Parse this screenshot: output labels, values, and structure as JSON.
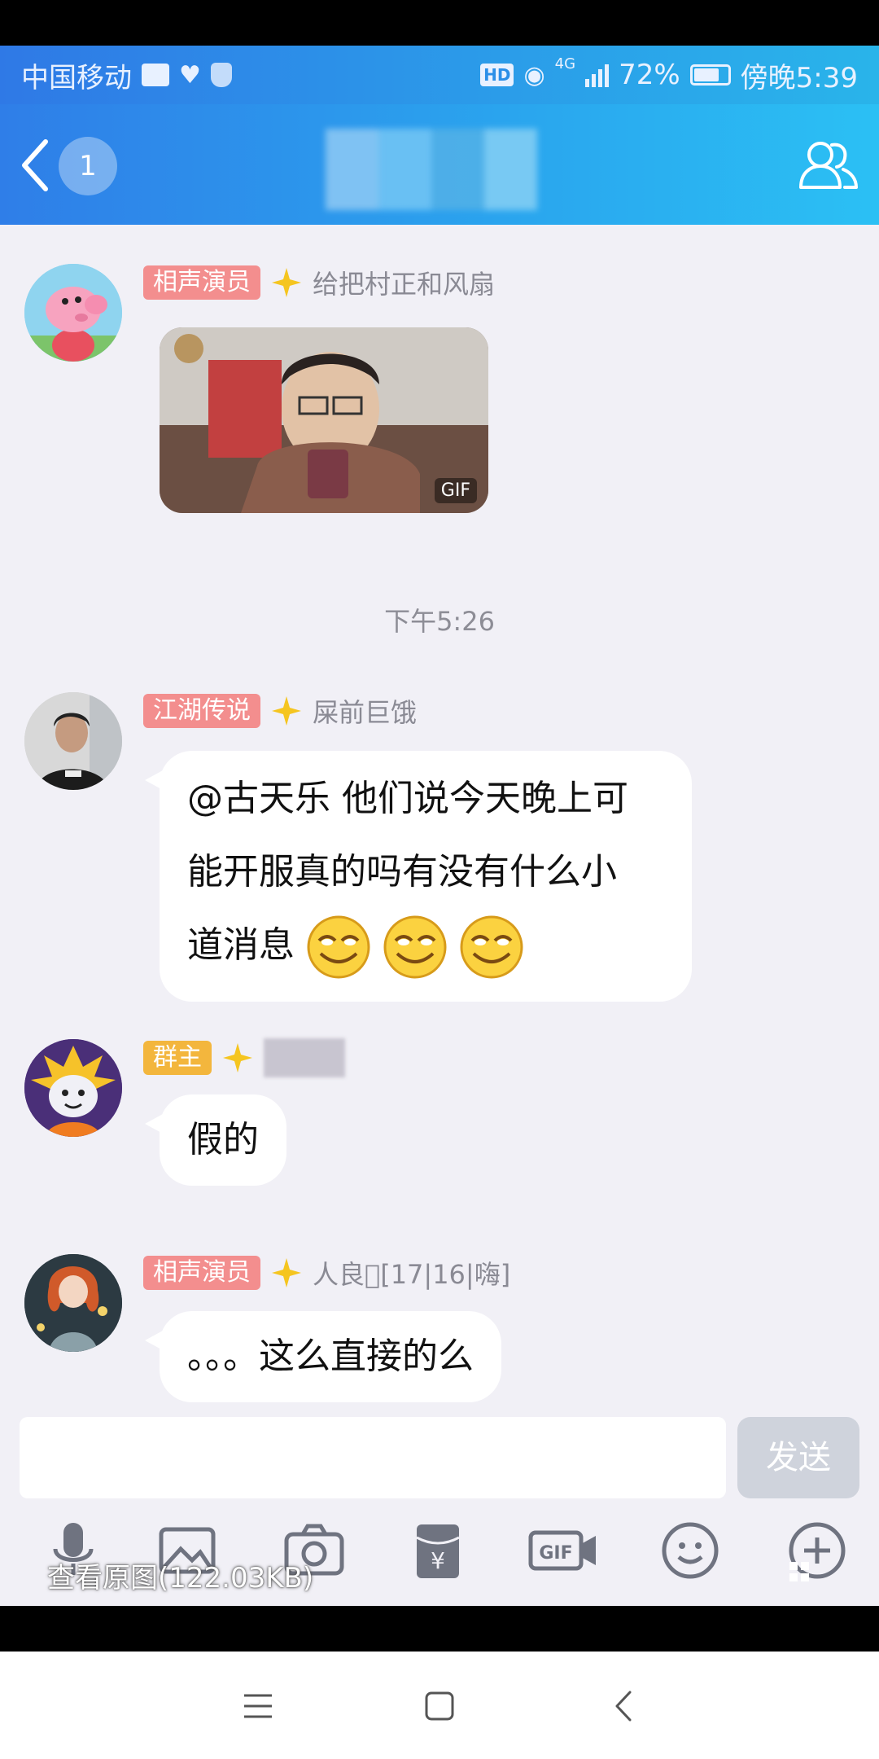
{
  "status_bar": {
    "carrier": "中国移动",
    "hd": "HD",
    "network": "4G",
    "battery": "72%",
    "time": "傍晚5:39"
  },
  "header": {
    "unread_count": "1",
    "title": ""
  },
  "messages": [
    {
      "tag": "相声演员",
      "tag_color": "#f38e8e",
      "nickname": "给把村正和风扇",
      "type": "gif",
      "gif_label": "GIF"
    },
    {
      "type": "timestamp",
      "text": "下午5:26"
    },
    {
      "tag": "江湖传说",
      "tag_color": "#f38e8e",
      "nickname": "屎前巨饿",
      "type": "text",
      "lines": [
        "@古天乐 他们说今天晚上可",
        "能开服真的吗有没有什么小",
        "道消息"
      ]
    },
    {
      "tag": "群主",
      "tag_color": "#f3b63d",
      "nickname": "",
      "type": "text",
      "lines": [
        "假的"
      ]
    },
    {
      "tag": "相声演员",
      "tag_color": "#f38e8e",
      "nickname": "人良\u0000[17|16|嗨]",
      "type": "text",
      "lines": [
        "。。。这么直接的么"
      ]
    }
  ],
  "input": {
    "send_label": "发送"
  },
  "toolbar": {
    "icons": [
      "microphone-icon",
      "image-icon",
      "camera-icon",
      "red-packet-icon",
      "gif-icon",
      "emoji-icon",
      "plus-icon"
    ],
    "gif_text": "GIF",
    "red_packet_text": "¥"
  },
  "overlay": {
    "view_original": "查看原图(122.03KB)"
  },
  "colors": {
    "header_start": "#2f7ee8",
    "header_end": "#2bc0f4",
    "chat_bg": "#f1f0f6",
    "tag_red": "#f38e8e",
    "tag_gold": "#f3b63d"
  }
}
